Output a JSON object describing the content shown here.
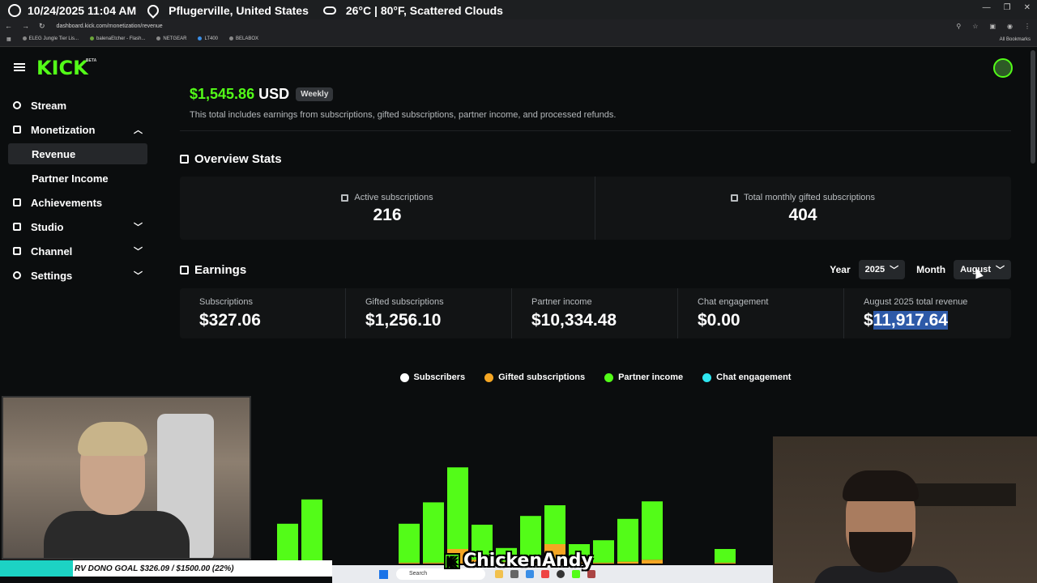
{
  "overlay": {
    "datetime": "10/24/2025 11:04 AM",
    "location": "Pflugerville, United States",
    "weather": "26°C | 80°F, Scattered Clouds"
  },
  "browser": {
    "url": "dashboard.kick.com/monetization/revenue",
    "bookmarks": [
      "ELEG Jungle Tier Lis...",
      "balenaEtcher - Flash...",
      "NETGEAR",
      "LT400",
      "BELABOX"
    ],
    "all_bookmarks": "All Bookmarks"
  },
  "header": {
    "logo": "KICK",
    "beta": "BETA"
  },
  "sidebar": {
    "items": [
      {
        "label": "Stream"
      },
      {
        "label": "Monetization"
      },
      {
        "label": "Revenue"
      },
      {
        "label": "Partner Income"
      },
      {
        "label": "Achievements"
      },
      {
        "label": "Studio"
      },
      {
        "label": "Channel"
      },
      {
        "label": "Settings"
      }
    ]
  },
  "summary": {
    "amount": "$1,545.86",
    "currency": "USD",
    "period_badge": "Weekly",
    "description": "This total includes earnings from subscriptions, gifted subscriptions, partner income, and processed refunds."
  },
  "overview": {
    "title": "Overview Stats",
    "stats": [
      {
        "label": "Active subscriptions",
        "value": "216"
      },
      {
        "label": "Total monthly gifted subscriptions",
        "value": "404"
      }
    ]
  },
  "earnings": {
    "title": "Earnings",
    "year_label": "Year",
    "year_value": "2025",
    "month_label": "Month",
    "month_value": "August",
    "cards": [
      {
        "label": "Subscriptions",
        "value": "$327.06"
      },
      {
        "label": "Gifted subscriptions",
        "value": "$1,256.10"
      },
      {
        "label": "Partner income",
        "value": "$10,334.48"
      },
      {
        "label": "Chat engagement",
        "value": "$0.00"
      },
      {
        "label": "August 2025 total revenue",
        "value_prefix": "$",
        "value_highlight": "11,917.64"
      }
    ]
  },
  "chart_data": {
    "type": "bar",
    "stacked": true,
    "legend": "top-center",
    "series": [
      {
        "name": "Subscribers",
        "color": "#ffffff"
      },
      {
        "name": "Gifted subscriptions",
        "color": "#f5a623"
      },
      {
        "name": "Partner income",
        "color": "#53fc18"
      },
      {
        "name": "Chat engagement",
        "color": "#2ee6f0"
      }
    ],
    "bars": [
      {
        "green": 2,
        "gold": 1
      },
      {
        "green": 38,
        "gold": 3
      },
      {
        "green": 65,
        "gold": 1
      },
      {
        "green": 0,
        "gold": 0
      },
      {
        "green": 0,
        "gold": 0
      },
      {
        "green": 0,
        "gold": 0
      },
      {
        "green": 40,
        "gold": 1
      },
      {
        "green": 62,
        "gold": 1
      },
      {
        "green": 84,
        "gold": 15
      },
      {
        "green": 36,
        "gold": 4
      },
      {
        "green": 14,
        "gold": 2
      },
      {
        "green": 48,
        "gold": 1
      },
      {
        "green": 40,
        "gold": 20
      },
      {
        "green": 16,
        "gold": 4
      },
      {
        "green": 23,
        "gold": 1
      },
      {
        "green": 44,
        "gold": 2
      },
      {
        "green": 60,
        "gold": 4
      },
      {
        "green": 0,
        "gold": 0
      },
      {
        "green": 0,
        "gold": 0
      },
      {
        "green": 14,
        "gold": 1
      }
    ]
  },
  "overlays": {
    "dono_goal": "RV DONO GOAL $326.09 / $1500.00 (22%)",
    "streamer_name": "ChickenAndy",
    "taskbar_search": "Search"
  }
}
